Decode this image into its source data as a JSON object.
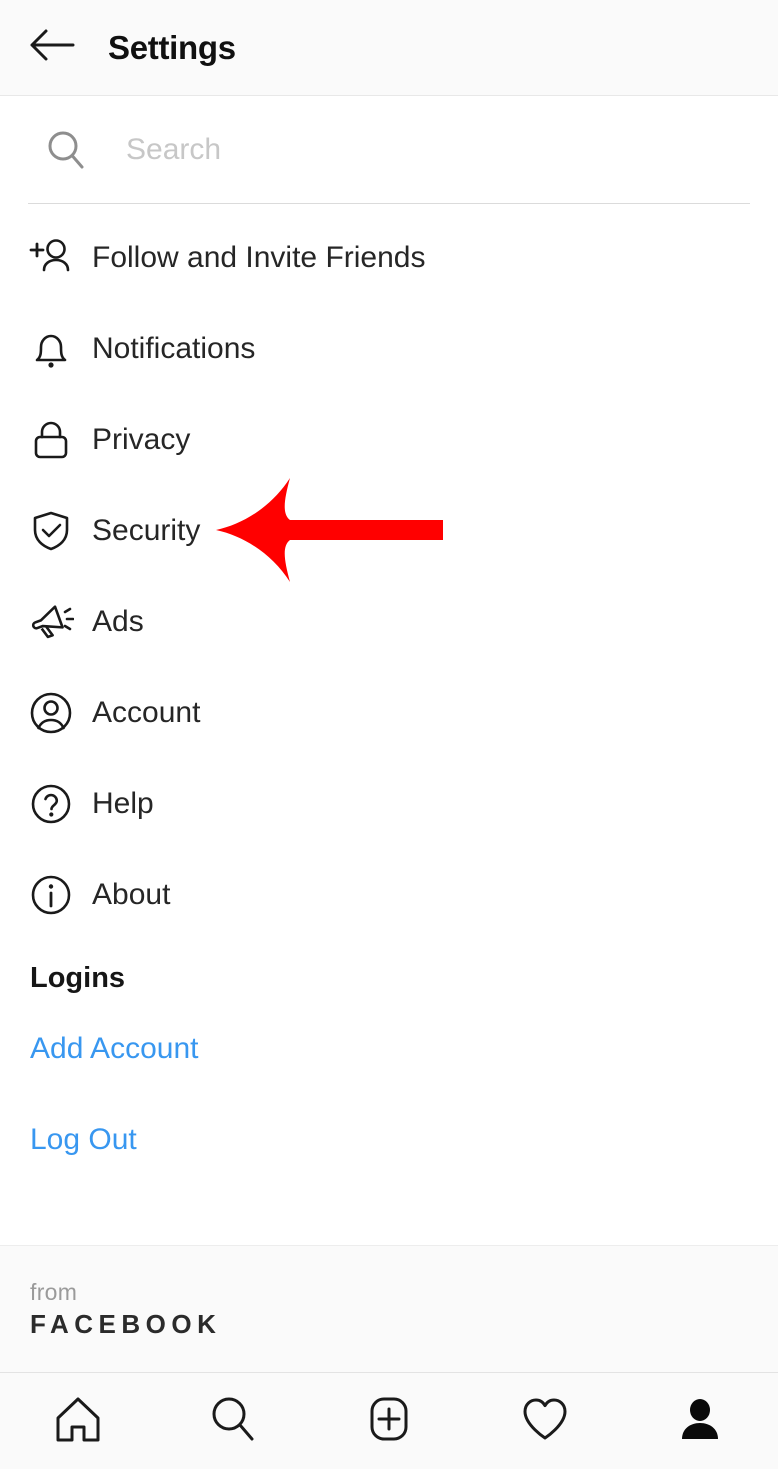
{
  "header": {
    "title": "Settings",
    "back_icon": "arrow-left-icon"
  },
  "search": {
    "placeholder": "Search",
    "value": "",
    "icon": "search-icon"
  },
  "menu": {
    "items": [
      {
        "label": "Follow and Invite Friends",
        "icon": "person-plus-icon"
      },
      {
        "label": "Notifications",
        "icon": "bell-icon"
      },
      {
        "label": "Privacy",
        "icon": "lock-icon"
      },
      {
        "label": "Security",
        "icon": "shield-check-icon"
      },
      {
        "label": "Ads",
        "icon": "megaphone-icon"
      },
      {
        "label": "Account",
        "icon": "person-circle-icon"
      },
      {
        "label": "Help",
        "icon": "question-circle-icon"
      },
      {
        "label": "About",
        "icon": "info-circle-icon"
      }
    ]
  },
  "logins": {
    "heading": "Logins",
    "add_account": "Add Account",
    "log_out": "Log Out"
  },
  "brand": {
    "from": "from",
    "name": "FACEBOOK"
  },
  "bottom_nav": {
    "items": [
      {
        "icon": "home-icon"
      },
      {
        "icon": "search-icon"
      },
      {
        "icon": "plus-square-icon"
      },
      {
        "icon": "heart-icon"
      },
      {
        "icon": "profile-person-icon"
      }
    ]
  },
  "annotation": {
    "type": "arrow-left",
    "color": "#FF0000",
    "points_at": "Privacy"
  },
  "colors": {
    "link_blue": "#3897F0",
    "text_primary": "#262626",
    "placeholder": "#C7C7C7",
    "surface": "#FAFAFA",
    "annotation_red": "#FF0000"
  }
}
